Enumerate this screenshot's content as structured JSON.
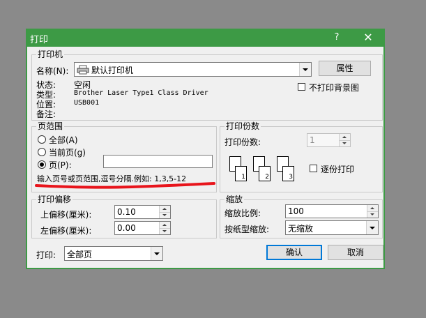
{
  "window": {
    "title": "打印",
    "help": "?",
    "close": "✕"
  },
  "printer": {
    "group": "打印机",
    "name_label": "名称(N):",
    "name_value": "默认打印机",
    "status_label": "状态:",
    "status_value": "空闲",
    "type_label": "类型:",
    "type_value": "Brother Laser Type1 Class Driver",
    "location_label": "位置:",
    "location_value": "USB001",
    "comment_label": "备注:",
    "properties_button": "属性",
    "no_background_label": "不打印背景图"
  },
  "range": {
    "group": "页范围",
    "all": "全部(A)",
    "current": "当前页(g)",
    "pages": "页(P):",
    "hint": "输入页号或页范围,逗号分隔.例如: 1,3,5-12"
  },
  "copies": {
    "group": "打印份数",
    "label": "打印份数:",
    "value": "1",
    "collate_label": "逐份打印",
    "page_numbers": [
      "1",
      "2",
      "3"
    ]
  },
  "offset": {
    "group": "打印偏移",
    "top_label": "上偏移(厘米):",
    "top_value": "0.10",
    "left_label": "左偏移(厘米):",
    "left_value": "0.00"
  },
  "zoom": {
    "group": "缩放",
    "ratio_label": "缩放比例:",
    "ratio_value": "100",
    "fit_label": "按纸型缩放:",
    "fit_value": "无缩放"
  },
  "footer": {
    "print_label": "打印:",
    "print_value": "全部页",
    "ok": "确认",
    "cancel": "取消"
  },
  "colors": {
    "titlebar": "#3d9a45",
    "annotation": "#e8141b"
  }
}
